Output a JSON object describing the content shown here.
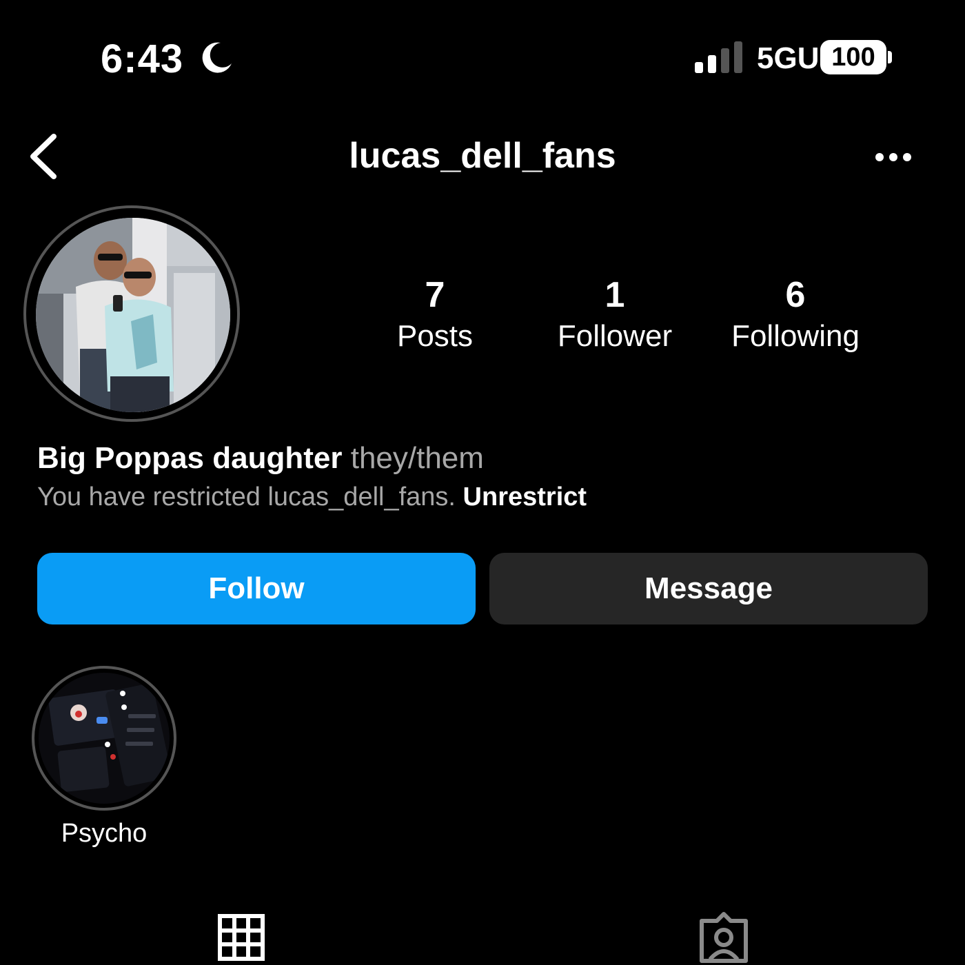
{
  "status_bar": {
    "time": "6:43",
    "network": "5GUC",
    "battery": "100",
    "icons": [
      "moon-icon",
      "signal-icon",
      "battery-icon"
    ]
  },
  "header": {
    "username": "lucas_dell_fans",
    "icons": [
      "back-chevron-icon",
      "more-options-icon"
    ]
  },
  "stats": [
    {
      "value": "7",
      "label": "Posts"
    },
    {
      "value": "1",
      "label": "Follower"
    },
    {
      "value": "6",
      "label": "Following"
    }
  ],
  "bio": {
    "name": "Big Poppas daughter",
    "pronouns": "they/them",
    "restrict_text": "You have restricted lucas_dell_fans.",
    "unrestrict_label": "Unrestrict"
  },
  "actions": {
    "follow_label": "Follow",
    "message_label": "Message"
  },
  "highlights": [
    {
      "label": "Psycho"
    }
  ],
  "tabs": [
    "grid-icon",
    "tagged-icon"
  ],
  "colors": {
    "background": "#000000",
    "follow_button": "#0a9cf5",
    "message_button": "#262626",
    "secondary_text": "#a8a8a8"
  }
}
